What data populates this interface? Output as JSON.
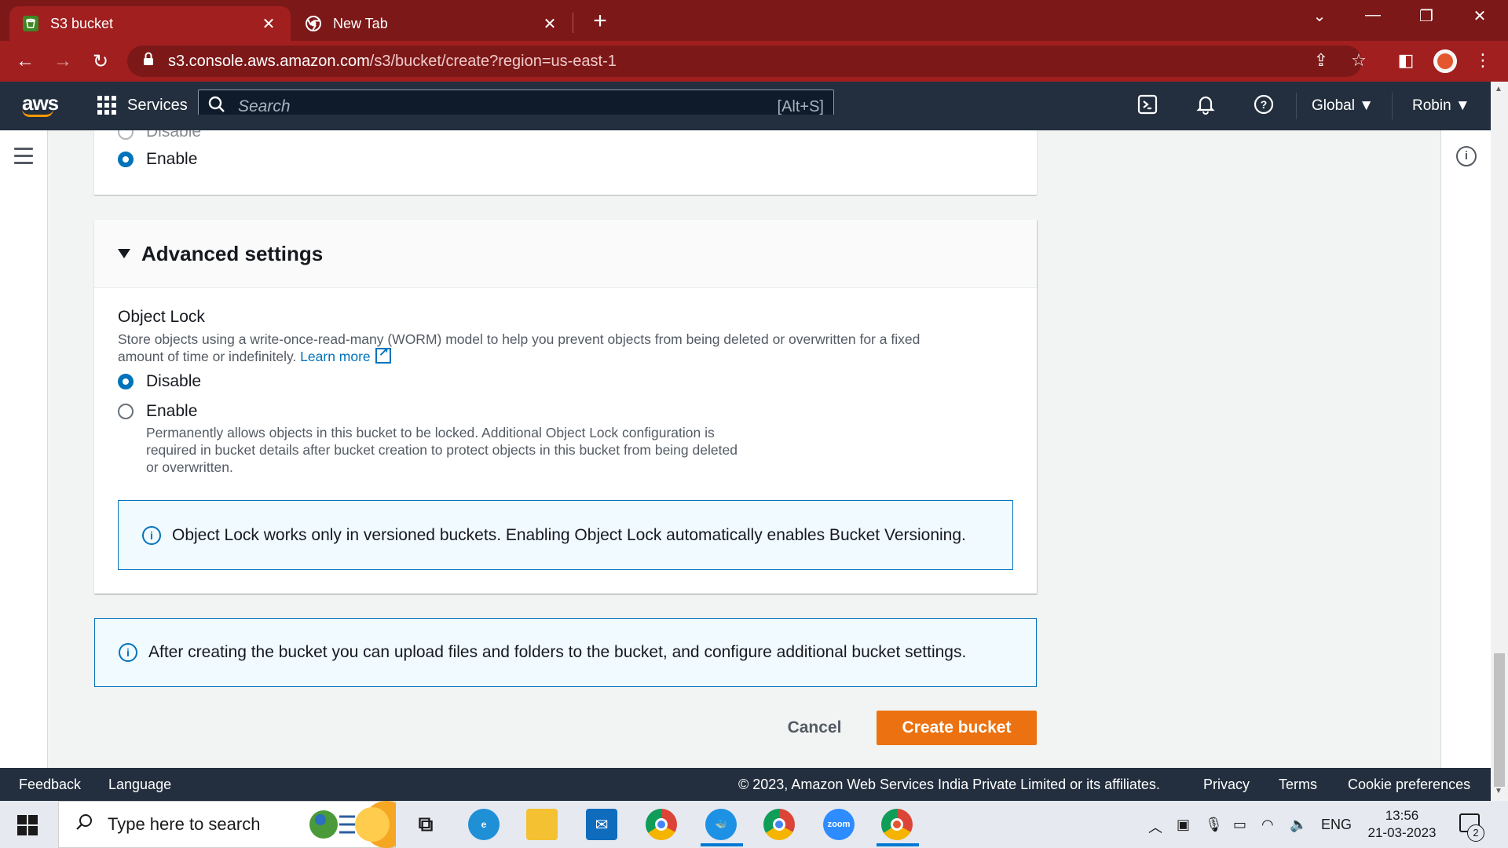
{
  "browser": {
    "tabs": [
      {
        "title": "S3 bucket",
        "icon": "aws-s3-favicon",
        "active": true
      },
      {
        "title": "New Tab",
        "icon": "chrome-favicon",
        "active": false
      }
    ],
    "url_host": "s3.console.aws.amazon.com",
    "url_path": "/s3/bucket/create?region=us-east-1",
    "colors": {
      "frame": "#7d1818",
      "toolbar": "#a11f1f"
    }
  },
  "aws_nav": {
    "logo": "aws",
    "services_label": "Services",
    "search_placeholder": "Search",
    "search_shortcut": "[Alt+S]",
    "region_label": "Global",
    "user_label": "Robin"
  },
  "top_section": {
    "partial_option_label": "Disable",
    "selected_option_label": "Enable"
  },
  "advanced": {
    "header": "Advanced settings",
    "object_lock_label": "Object Lock",
    "object_lock_desc_1": "Store objects using a write-once-read-many (WORM) model to help you prevent objects from being deleted or overwritten for a fixed",
    "object_lock_desc_2": "amount of time or indefinitely.",
    "learn_more": "Learn more",
    "options": [
      {
        "label": "Disable",
        "selected": true
      },
      {
        "label": "Enable",
        "selected": false
      }
    ],
    "enable_desc_1": "Permanently allows objects in this bucket to be locked. Additional Object Lock configuration is",
    "enable_desc_2": "required in bucket details after bucket creation to protect objects in this bucket from being deleted",
    "enable_desc_3": "or overwritten.",
    "info_alert": "Object Lock works only in versioned buckets. Enabling Object Lock automatically enables Bucket Versioning."
  },
  "bottom_alert": "After creating the bucket you can upload files and folders to the bucket, and configure additional bucket settings.",
  "actions": {
    "cancel": "Cancel",
    "create": "Create bucket",
    "create_color": "#ec7211"
  },
  "aws_footer": {
    "feedback": "Feedback",
    "language": "Language",
    "copyright": "© 2023, Amazon Web Services India Private Limited or its affiliates.",
    "privacy": "Privacy",
    "terms": "Terms",
    "cookies": "Cookie preferences"
  },
  "taskbar": {
    "search_placeholder": "Type here to search",
    "language": "ENG",
    "time": "13:56",
    "date": "21-03-2023",
    "notification_count": "2",
    "zoom_label": "zoom"
  }
}
